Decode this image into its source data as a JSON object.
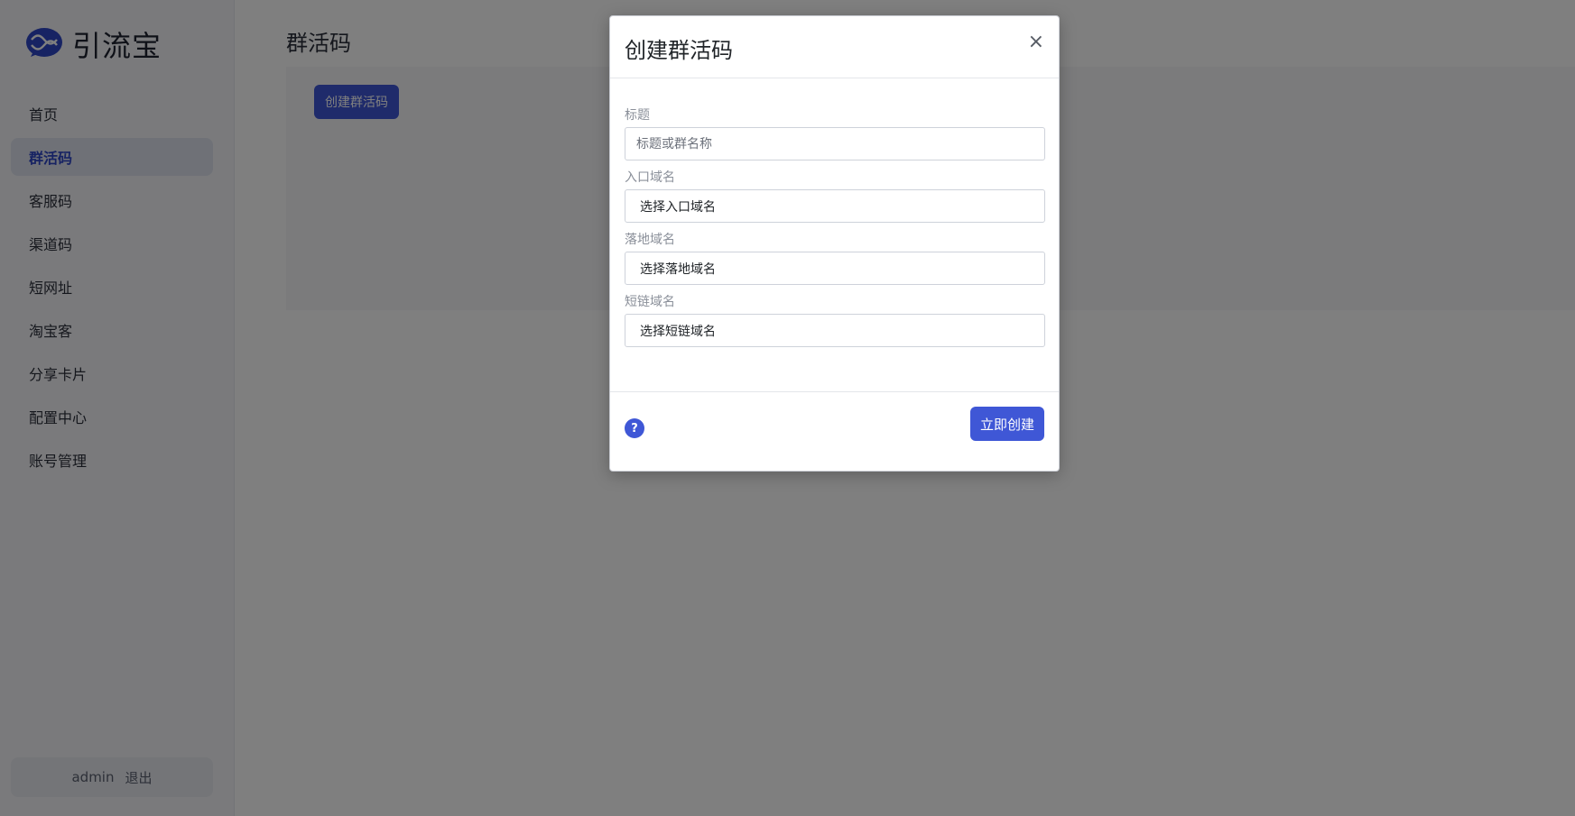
{
  "app": {
    "brand": "引流宝"
  },
  "sidebar": {
    "items": [
      {
        "label": "首页"
      },
      {
        "label": "群活码",
        "active": true
      },
      {
        "label": "客服码"
      },
      {
        "label": "渠道码"
      },
      {
        "label": "短网址"
      },
      {
        "label": "淘宝客"
      },
      {
        "label": "分享卡片"
      },
      {
        "label": "配置中心"
      },
      {
        "label": "账号管理"
      }
    ],
    "user": {
      "name": "admin",
      "logout_label": "退出"
    }
  },
  "main": {
    "title": "群活码",
    "create_button_label": "创建群活码"
  },
  "modal": {
    "title": "创建群活码",
    "close_symbol": "×",
    "fields": {
      "title": {
        "label": "标题",
        "placeholder": "标题或群名称"
      },
      "entry_domain": {
        "label": "入口域名",
        "value": "选择入口域名"
      },
      "landing_domain": {
        "label": "落地域名",
        "value": "选择落地域名"
      },
      "short_domain": {
        "label": "短链域名",
        "value": "选择短链域名"
      }
    },
    "help_symbol": "?",
    "submit_label": "立即创建"
  },
  "colors": {
    "accent": "#3f57d6",
    "overlay": "rgba(0,0,0,0.5)",
    "sidebar_active_bg": "#dfe3ef"
  }
}
